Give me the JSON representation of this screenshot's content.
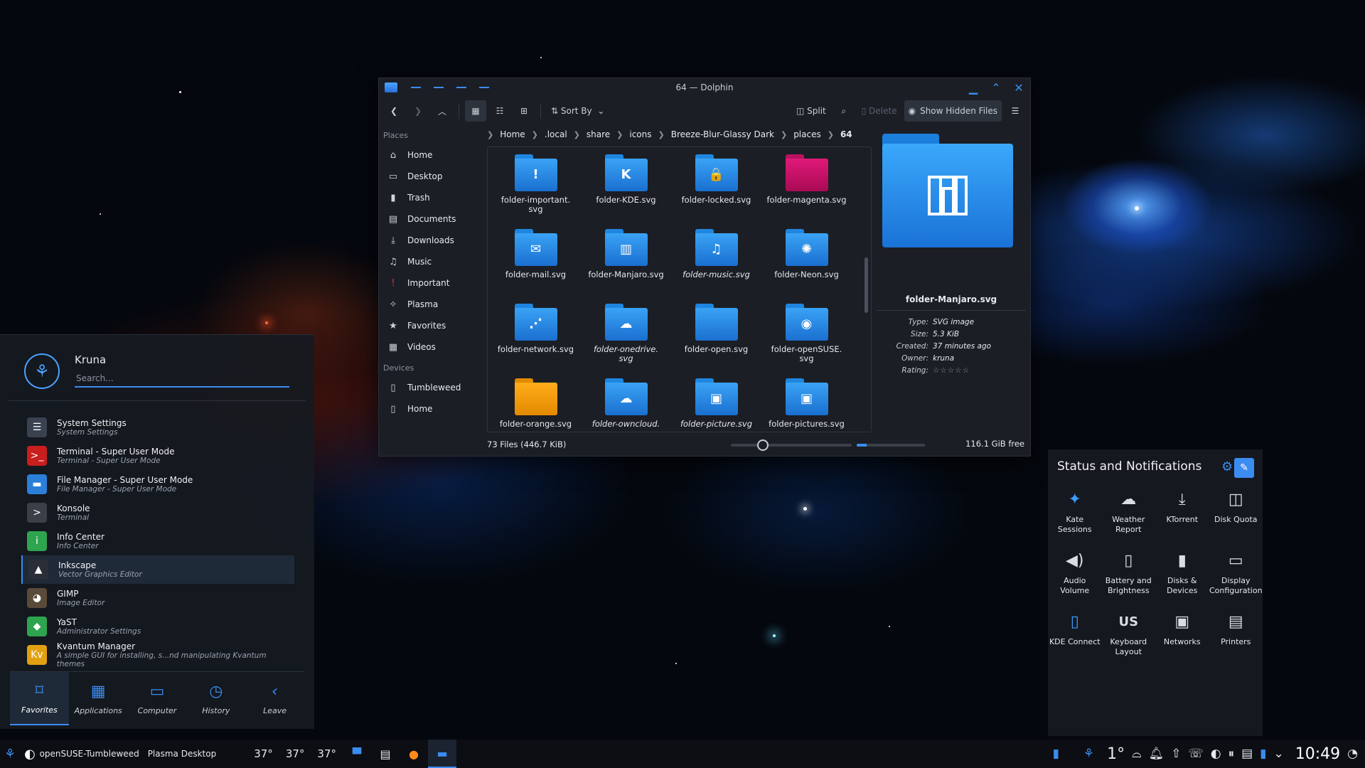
{
  "dolphin": {
    "title": "64 — Dolphin",
    "toolbar": {
      "sort_label": "Sort By",
      "split_label": "Split",
      "delete_label": "Delete",
      "hidden_files_label": "Show Hidden Files"
    },
    "places_heading": "Places",
    "places": [
      {
        "label": "Home",
        "icon": "home-icon"
      },
      {
        "label": "Desktop",
        "icon": "desktop-icon"
      },
      {
        "label": "Trash",
        "icon": "trash-icon"
      },
      {
        "label": "Documents",
        "icon": "documents-icon"
      },
      {
        "label": "Downloads",
        "icon": "downloads-icon"
      },
      {
        "label": "Music",
        "icon": "music-icon"
      },
      {
        "label": "Important",
        "icon": "exclamation-icon"
      },
      {
        "label": "Plasma",
        "icon": "plasma-icon"
      },
      {
        "label": "Favorites",
        "icon": "star-icon"
      },
      {
        "label": "Videos",
        "icon": "videos-icon"
      }
    ],
    "devices_heading": "Devices",
    "devices": [
      {
        "label": "Tumbleweed",
        "icon": "drive-icon"
      },
      {
        "label": "Home",
        "icon": "drive-icon"
      }
    ],
    "breadcrumb": [
      "Home",
      ".local",
      "share",
      "icons",
      "Breeze-Blur-Glassy Dark",
      "places",
      "64"
    ],
    "files": [
      {
        "name": "folder-important.\nsvg",
        "color": "blue",
        "glyph": "!",
        "italic": false
      },
      {
        "name": "folder-KDE.svg",
        "color": "blue",
        "glyph": "K",
        "italic": false
      },
      {
        "name": "folder-locked.svg",
        "color": "blue",
        "glyph": "🔒",
        "italic": false
      },
      {
        "name": "folder-magenta.svg",
        "color": "magenta",
        "glyph": "",
        "italic": false
      },
      {
        "name": "folder-mail.svg",
        "color": "blue",
        "glyph": "✉",
        "italic": false
      },
      {
        "name": "folder-Manjaro.svg",
        "color": "blue",
        "glyph": "▥",
        "italic": false
      },
      {
        "name": "folder-music.svg",
        "color": "blue",
        "glyph": "♫",
        "italic": true
      },
      {
        "name": "folder-Neon.svg",
        "color": "blue",
        "glyph": "✺",
        "italic": false
      },
      {
        "name": "folder-network.svg",
        "color": "blue",
        "glyph": "⋰",
        "italic": false
      },
      {
        "name": "folder-onedrive.\nsvg",
        "color": "blue",
        "glyph": "☁",
        "italic": true
      },
      {
        "name": "folder-open.svg",
        "color": "blue",
        "glyph": "",
        "italic": false
      },
      {
        "name": "folder-openSUSE.\nsvg",
        "color": "blue",
        "glyph": "◉",
        "italic": false
      },
      {
        "name": "folder-orange.svg",
        "color": "orange",
        "glyph": "",
        "italic": false
      },
      {
        "name": "folder-owncloud.",
        "color": "blue",
        "glyph": "☁",
        "italic": true
      },
      {
        "name": "folder-picture.svg",
        "color": "blue",
        "glyph": "▣",
        "italic": true
      },
      {
        "name": "folder-pictures.svg",
        "color": "blue",
        "glyph": "▣",
        "italic": false
      }
    ],
    "preview": {
      "name": "folder-Manjaro.svg",
      "meta": [
        {
          "k": "Type:",
          "v": "SVG image"
        },
        {
          "k": "Size:",
          "v": "5.3 KiB"
        },
        {
          "k": "Created:",
          "v": "37 minutes ago"
        },
        {
          "k": "Owner:",
          "v": "kruna"
        },
        {
          "k": "Rating:",
          "v": "☆☆☆☆☆"
        }
      ]
    },
    "status": {
      "count": "73 Files (446.7 KiB)",
      "free": "116.1 GiB free",
      "space_used_fraction": 0.15
    }
  },
  "kickoff": {
    "user": "Kruna",
    "search_placeholder": "Search...",
    "apps": [
      {
        "title": "System Settings",
        "sub": "System Settings",
        "icon": "☰",
        "bg": "#3a4250",
        "hl": false
      },
      {
        "title": "Terminal - Super User Mode",
        "sub": "Terminal - Super User Mode",
        "icon": ">_",
        "bg": "#c81e1e",
        "hl": false
      },
      {
        "title": "File Manager - Super User Mode",
        "sub": "File Manager - Super User Mode",
        "icon": "▬",
        "bg": "#2b7fd9",
        "hl": false
      },
      {
        "title": "Konsole",
        "sub": "Terminal",
        "icon": ">",
        "bg": "#3a3f48",
        "hl": false
      },
      {
        "title": "Info Center",
        "sub": "Info Center",
        "icon": "i",
        "bg": "#2ea44f",
        "hl": false
      },
      {
        "title": "Inkscape",
        "sub": "Vector Graphics Editor",
        "icon": "▲",
        "bg": "#2a2e36",
        "hl": true
      },
      {
        "title": "GIMP",
        "sub": "Image Editor",
        "icon": "◕",
        "bg": "#5a4a3a",
        "hl": false
      },
      {
        "title": "YaST",
        "sub": "Administrator Settings",
        "icon": "◆",
        "bg": "#2ea44f",
        "hl": false
      },
      {
        "title": "Kvantum Manager",
        "sub": "A simple GUI for installing, s...nd manipulating Kvantum themes",
        "icon": "Kv",
        "bg": "#e0a010",
        "hl": false
      }
    ],
    "tabs": [
      {
        "label": "Favorites",
        "icon": "⌑",
        "active": true
      },
      {
        "label": "Applications",
        "icon": "▦",
        "active": false
      },
      {
        "label": "Computer",
        "icon": "▭",
        "active": false
      },
      {
        "label": "History",
        "icon": "◷",
        "active": false
      },
      {
        "label": "Leave",
        "icon": "‹",
        "active": false
      }
    ]
  },
  "status_panel": {
    "title": "Status and Notifications",
    "items": [
      {
        "label": "Kate Sessions",
        "icon": "✦",
        "blue": true
      },
      {
        "label": "Weather Report",
        "icon": "☁",
        "blue": false
      },
      {
        "label": "KTorrent",
        "icon": "⤓",
        "blue": false
      },
      {
        "label": "Disk Quota",
        "icon": "◫",
        "blue": false
      },
      {
        "label": "Audio Volume",
        "icon": "◀)",
        "blue": false
      },
      {
        "label": "Battery and\nBrightness",
        "icon": "▯",
        "blue": false
      },
      {
        "label": "Disks & Devices",
        "icon": "▮",
        "blue": false
      },
      {
        "label": "Display\nConfiguration",
        "icon": "▭",
        "blue": false
      },
      {
        "label": "KDE Connect",
        "icon": "▯",
        "blue": true
      },
      {
        "label": "Keyboard\nLayout",
        "icon": "US",
        "blue": false,
        "text": true
      },
      {
        "label": "Networks",
        "icon": "▣",
        "blue": false
      },
      {
        "label": "Printers",
        "icon": "▤",
        "blue": false
      }
    ]
  },
  "taskbar": {
    "distro": "openSUSE-Tumbleweed",
    "desktop": "Plasma Desktop",
    "temps": [
      "37°",
      "37°",
      "37°"
    ],
    "weather_temp": "1°",
    "clock": "10:49"
  }
}
